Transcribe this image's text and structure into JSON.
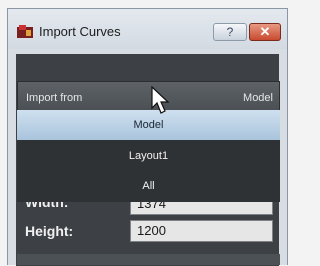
{
  "window": {
    "title": "Import Curves",
    "help_label": "?",
    "close_label": "✕"
  },
  "import": {
    "label": "Import from",
    "value": "Model"
  },
  "dropdown": {
    "options": [
      "Model",
      "Layout1",
      "All"
    ],
    "selected": "Model"
  },
  "fields": {
    "width_label": "Width:",
    "width_value": "1374",
    "height_label": "Height:",
    "height_value": "1200"
  },
  "icons": {
    "app": "import-curves-app-icon",
    "cursor": "mouse-pointer-icon"
  }
}
